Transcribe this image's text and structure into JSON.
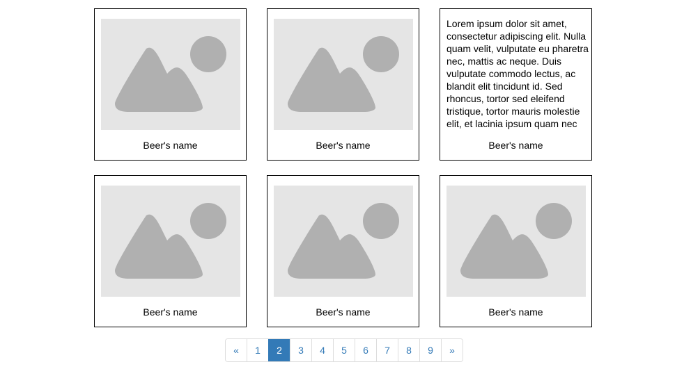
{
  "cards": [
    {
      "type": "image",
      "image_icon": "image-placeholder-icon",
      "name": "Beer's name"
    },
    {
      "type": "image",
      "image_icon": "image-placeholder-icon",
      "name": "Beer's name"
    },
    {
      "type": "text",
      "description": "Lorem ipsum dolor sit amet, consectetur adipiscing elit. Nulla quam velit, vulputate eu pharetra nec, mattis ac neque. Duis vulputate commodo lectus, ac blandit elit tincidunt id. Sed rhoncus, tortor sed eleifend tristique, tortor mauris molestie elit, et lacinia ipsum quam nec",
      "name": "Beer's name"
    },
    {
      "type": "image",
      "image_icon": "image-placeholder-icon",
      "name": "Beer's name"
    },
    {
      "type": "image",
      "image_icon": "image-placeholder-icon",
      "name": "Beer's name"
    },
    {
      "type": "image",
      "image_icon": "image-placeholder-icon",
      "name": "Beer's name"
    }
  ],
  "pagination": {
    "prev_label": "«",
    "pages": [
      "1",
      "2",
      "3",
      "4",
      "5",
      "6",
      "7",
      "8",
      "9"
    ],
    "active_page": "2",
    "next_label": "»"
  },
  "colors": {
    "accent": "#337ab7",
    "placeholder_bg": "#e5e5e5",
    "placeholder_shape": "#b0b0b0"
  }
}
